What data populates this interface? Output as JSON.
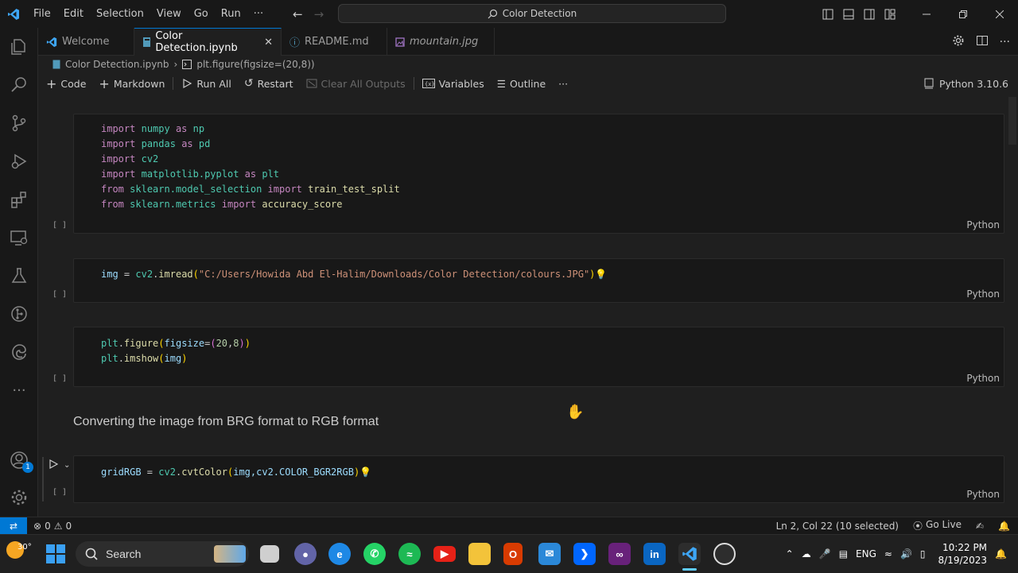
{
  "window": {
    "title": "Color Detection"
  },
  "menu": [
    "File",
    "Edit",
    "Selection",
    "View",
    "Go",
    "Run",
    "···"
  ],
  "tabs": [
    {
      "label": "Welcome"
    },
    {
      "label": "Color Detection.ipynb"
    },
    {
      "label": "README.md"
    },
    {
      "label": "mountain.jpg"
    }
  ],
  "breadcrumb": {
    "file": "Color Detection.ipynb",
    "symbol": "plt.figure(figsize=(20,8))"
  },
  "toolbar": {
    "code": "Code",
    "markdown": "Markdown",
    "run_all": "Run All",
    "restart": "Restart",
    "clear": "Clear All Outputs",
    "variables": "Variables",
    "outline": "Outline",
    "more": "···",
    "kernel": "Python 3.10.6"
  },
  "cells": [
    {
      "exec": "[ ]",
      "lang": "Python"
    },
    {
      "exec": "[ ]",
      "lang": "Python"
    },
    {
      "exec": "[ ]",
      "lang": "Python"
    },
    {
      "exec": "[ ]",
      "lang": "Python"
    }
  ],
  "code": {
    "c1": {
      "l1": {
        "kw": "import",
        "mod": "numpy",
        "as": "as",
        "alias": "np"
      },
      "l2": {
        "kw": "import",
        "mod": "pandas",
        "as": "as",
        "alias": "pd"
      },
      "l3": {
        "kw": "import",
        "mod": "cv2"
      },
      "l4": {
        "kw": "import",
        "mod": "matplotlib.pyplot",
        "as": "as",
        "alias": "plt"
      },
      "l5": {
        "kw": "from",
        "mod": "sklearn.model_selection",
        "kw2": "import",
        "name": "train_test_split"
      },
      "l6": {
        "kw": "from",
        "mod": "sklearn.metrics",
        "kw2": "import",
        "name": "accuracy_score"
      }
    },
    "c2": {
      "var": "img",
      "eq": " = ",
      "mod": "cv2",
      "dot": ".",
      "fn": "imread",
      "open": "(",
      "str": "\"C:/Users/Howida Abd El-Halim/Downloads/Color Detection/colours.JPG\"",
      "close": ")"
    },
    "c3": {
      "l1": {
        "mod": "plt",
        "dot": ".",
        "fn": "figure",
        "open": "(",
        "arg": "figsize",
        "eq": "=",
        "open2": "(",
        "num1": "20",
        "comma": ",",
        "num2": "8",
        "close2": ")",
        "close": ")"
      },
      "l2": {
        "mod": "plt",
        "dot": ".",
        "fn": "imshow",
        "open": "(",
        "arg": "img",
        "close": ")"
      }
    },
    "c4": {
      "var": "gridRGB",
      "eq": " = ",
      "mod": "cv2",
      "dot": ".",
      "fn": "cvtColor",
      "open": "(",
      "arg": "img,cv2.COLOR_BGR2RGB",
      "close": ")"
    }
  },
  "markdown_text": "Converting the image from BRG format to RGB format",
  "status": {
    "errors": "0",
    "warnings": "0",
    "position": "Ln 2, Col 22 (10 selected)",
    "golive": "Go Live"
  },
  "taskbar": {
    "weather": "30°",
    "search": "Search",
    "lang": "ENG",
    "time": "10:22 PM",
    "date": "8/19/2023"
  },
  "badges": {
    "accounts": "1"
  },
  "colors": {
    "accent": "#0078d4",
    "keyword": "#c586c0",
    "module": "#4ec9b0",
    "string": "#ce9178",
    "function": "#dcdcaa",
    "variable": "#9cdcfe"
  }
}
